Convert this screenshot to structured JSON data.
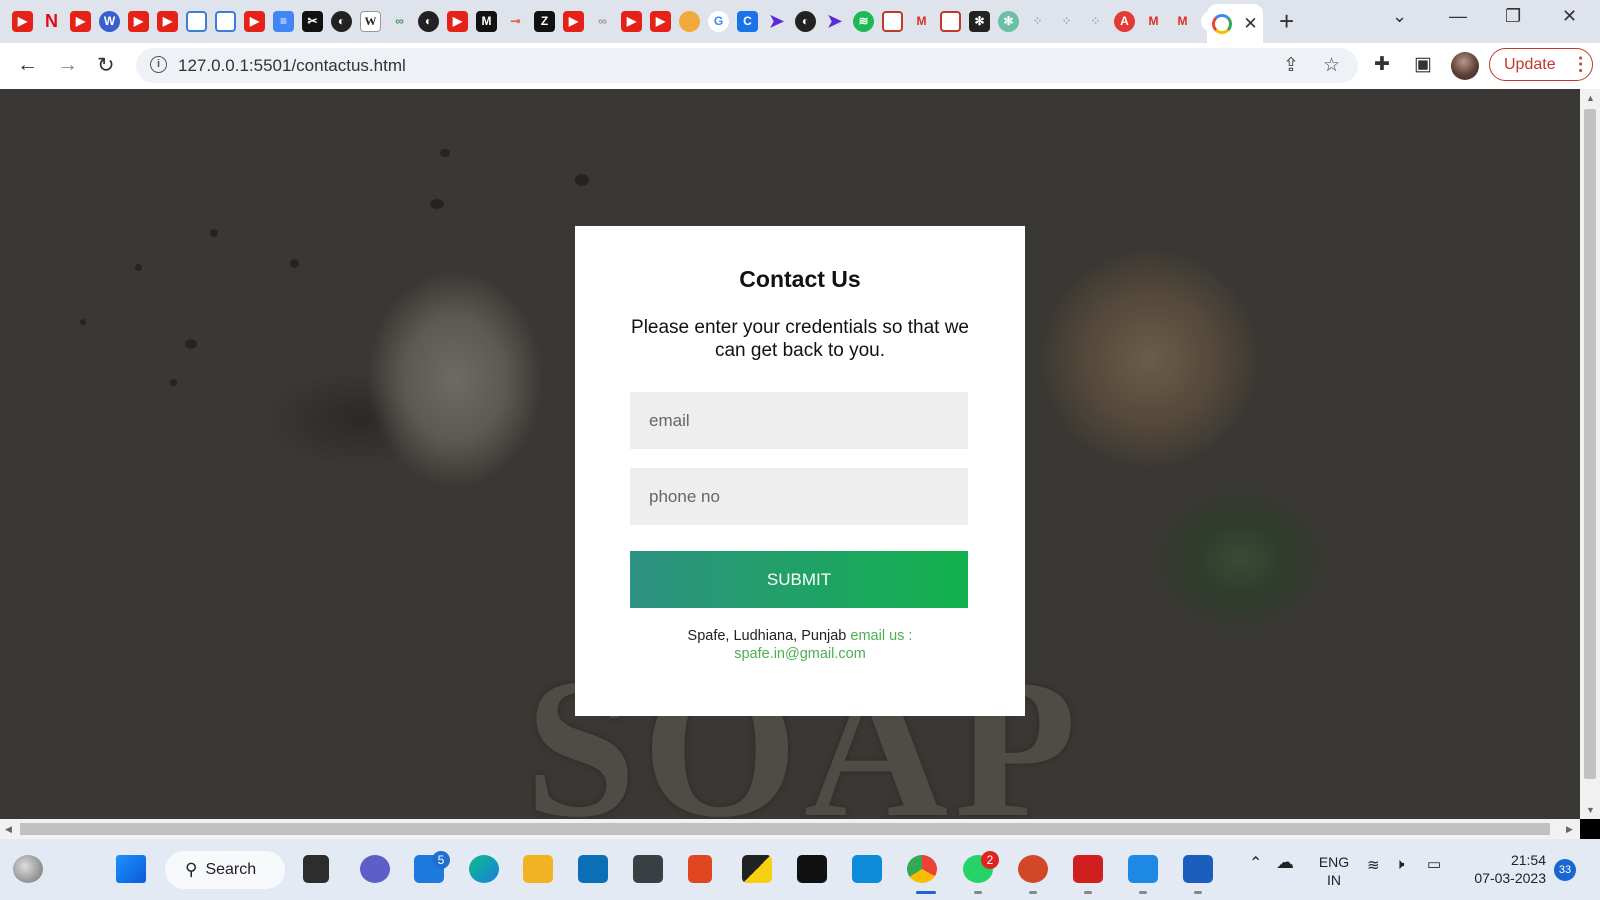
{
  "browser": {
    "url": "127.0.0.1:5501/contactus.html",
    "update_label": "Update"
  },
  "card": {
    "title": "Contact Us",
    "subtitle": "Please enter your credentials so that we can get back to you.",
    "email_placeholder": "email",
    "phone_placeholder": "phone no",
    "submit_label": "SUBMIT",
    "footer_address": "Spafe, Ludhiana, Punjab",
    "footer_email_label": "email us :",
    "footer_email": "spafe.in@gmail.com"
  },
  "background": {
    "word": "SOAP"
  },
  "taskbar": {
    "search_label": "Search",
    "mail_badge": "5",
    "whatsapp_badge": "2",
    "lang_top": "ENG",
    "lang_bottom": "IN",
    "time": "21:54",
    "date": "07-03-2023",
    "notification_count": "33"
  },
  "colors": {
    "submit_gradient_start": "#2e9181",
    "submit_gradient_end": "#12b14d",
    "link_green": "#4caf50",
    "update_red": "#c0392b"
  }
}
